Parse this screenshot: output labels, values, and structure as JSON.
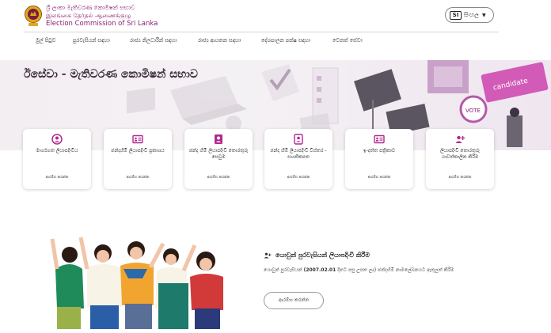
{
  "header": {
    "logo_line1": "ශ්‍රී ලංකා මැතිවරණ කොමිෂන් සභාව",
    "logo_line2": "இலங்கை தேர்தல் ஆணைக்குழு",
    "logo_line3": "Election Commission of Sri Lanka",
    "language_badge": "SI",
    "language_label": "සිංහල"
  },
  "nav": {
    "items": [
      "මුල් පිටුව",
      "පුරවැසියන් සඳහා",
      "රාජ්‍ය නිලධාරීන් සඳහා",
      "රාජ්‍ය ආයතන සඳහා",
      "දේශපාලන පක්ෂ සඳහා",
      "වෙනත් සේවා"
    ]
  },
  "hero": {
    "title_prefix": "ඊසේවා",
    "title_dash": "-",
    "title_suffix": "මැතිවරණ කොමිෂන් සභාව"
  },
  "services": [
    {
      "icon": "person-circle-icon",
      "title": "මාර්ගගත ලියාපදිංචිය",
      "action": "ආරම්භ කරන්න"
    },
    {
      "icon": "id-card-icon",
      "title": "ඡන්දහිමි ලියාපදිංචි ප්‍රකාශය",
      "action": "ආරම්භ කරන්න"
    },
    {
      "icon": "person-badge-icon",
      "title": "ඡන්ද හිමි ලියාපදිංචි තොරතුරු සෙවුම",
      "action": "ආරම්භ කරන්න"
    },
    {
      "icon": "person-badge-icon",
      "title": "ඡන්ද හිමි ලියාපදිංචි විස්තර - සහතිකපත",
      "action": "ආරම්භ කරන්න"
    },
    {
      "icon": "id-card-icon",
      "title": "ඉ-දත්ත පත්‍රිකාව",
      "action": "ආරම්භ කරන්න"
    },
    {
      "icon": "person-plus-icon",
      "title": "ලියාපදිංචි තොරතුරු යාවත්කාලීන කිරීම",
      "action": "ආරම්භ කරන්න"
    }
  ],
  "voter_registration": {
    "title": "යොවුන් පුරවැසියන් ලියාපදිංචි කිරීම",
    "desc_prefix": "යොවුන් පුරවැසියන්",
    "desc_date": "(2007.02.01",
    "desc_suffix": "දිනට පසු උපත ලද) ඡන්දහිමි නාමලේඛනයට ඇතුලත් කිරීම",
    "button_label": "ආරම්භ කරන්න"
  },
  "colors": {
    "accent": "#8a1f72",
    "icon": "#b0288f"
  }
}
